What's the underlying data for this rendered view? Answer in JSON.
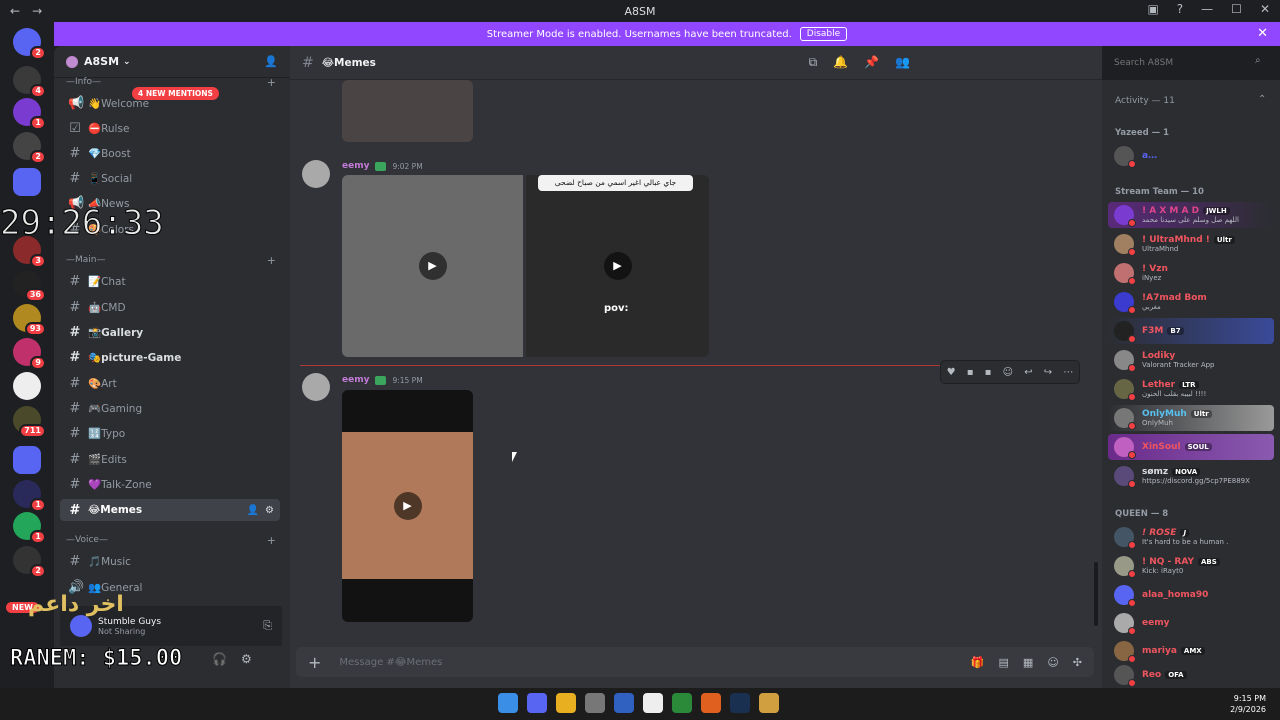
{
  "window": {
    "title": "A8SM"
  },
  "banner": {
    "text": "Streamer Mode is enabled. Usernames have been truncated.",
    "button": "Disable"
  },
  "guild": {
    "name": "A8SM",
    "mentions_pill": "4 NEW MENTIONS"
  },
  "server_rail": {
    "new_pill": "NEW",
    "badges": [
      "2",
      "4",
      "1",
      "2",
      "3",
      "36",
      "93",
      "9",
      "711",
      "1",
      "1",
      "2"
    ]
  },
  "categories": {
    "info": "—Info—",
    "main": "—Main—",
    "voice": "—Voice—"
  },
  "channels": [
    {
      "name": "👋Welcome"
    },
    {
      "name": "⛔Rulse"
    },
    {
      "name": "💎Boost"
    },
    {
      "name": "📱Social"
    },
    {
      "name": "📣News"
    },
    {
      "name": "🎨Colors"
    },
    {
      "name": "📝Chat"
    },
    {
      "name": "🤖CMD"
    },
    {
      "name": "📸Gallery"
    },
    {
      "name": "🎭picture-Game"
    },
    {
      "name": "🎨Art"
    },
    {
      "name": "🎮Gaming"
    },
    {
      "name": "🔢Typo"
    },
    {
      "name": "🎬Edits"
    },
    {
      "name": "💜Talk-Zone"
    },
    {
      "name": "😂Memes"
    },
    {
      "name": "🎵Music"
    },
    {
      "name": "👥General"
    }
  ],
  "overlay": {
    "timer": "29:26:33",
    "arabic": "اخر داعم",
    "donation": "RANEM: $15.00"
  },
  "user_panel": {
    "name": "Stumble Guys",
    "status": "Not Sharing"
  },
  "header": {
    "channel": "😂Memes",
    "search_placeholder": "Search A8SM"
  },
  "messages": [
    {
      "author": "eemy",
      "time": "9:02 PM",
      "caption": "جاي عبالي اغير اسمي من صباح لضحى",
      "overlay": "pov:"
    },
    {
      "author": "eemy",
      "time": "9:15 PM"
    }
  ],
  "composer": {
    "placeholder": "Message #😂Memes"
  },
  "members": {
    "activity": "Activity — 11",
    "groups": [
      {
        "title": "Yazeed — 1",
        "people": [
          {
            "name": "a…",
            "tag": "",
            "status": "",
            "color": "#5865f2"
          }
        ]
      },
      {
        "title": "Stream Team — 10",
        "people": [
          {
            "name": "! A X M A D",
            "tag": "JWLH",
            "status": "اللهم صل وسلم على سيدنا محمد",
            "color": "#e0458a"
          },
          {
            "name": "! UltraMhnd !",
            "tag": "Ultr",
            "status": "UltraMhnd",
            "color": "#f0555f"
          },
          {
            "name": "! Vzn",
            "tag": "",
            "status": "iNyez",
            "color": "#f0555f"
          },
          {
            "name": "!A7mad Bom",
            "tag": "",
            "status": "مغربي",
            "color": "#f0555f"
          },
          {
            "name": "F3M",
            "tag": "B7",
            "status": "",
            "color": "#f0555f"
          },
          {
            "name": "Lodiky",
            "tag": "",
            "status": "Valorant Tracker App",
            "color": "#f0555f"
          },
          {
            "name": "Lether",
            "tag": "LTR",
            "status": "لبيبه بقلب الحنون !!!!",
            "color": "#f0555f"
          },
          {
            "name": "OnlyMuh",
            "tag": "Ultr",
            "status": "OnlyMuh",
            "color": "#58c0f0"
          },
          {
            "name": "XinSoul",
            "tag": "SOUL",
            "status": "",
            "color": "#f0555f"
          },
          {
            "name": "sømz",
            "tag": "NOVA",
            "status": "https://discord.gg/5cp7PE889X",
            "color": "#dbdee1"
          }
        ]
      },
      {
        "title": "QUEEN — 8",
        "people": [
          {
            "name": "! ROSE",
            "tag": "J",
            "status": "It's hard to be a human .",
            "color": "#f0555f"
          },
          {
            "name": "! NQ - RAY",
            "tag": "ABS",
            "status": "Kick: iRayt0",
            "color": "#f0555f"
          },
          {
            "name": "alaa_homa90",
            "tag": "",
            "status": "",
            "color": "#f0555f"
          },
          {
            "name": "eemy",
            "tag": "",
            "status": "",
            "color": "#f0555f"
          },
          {
            "name": "mariya",
            "tag": "AMX",
            "status": "",
            "color": "#f0555f"
          },
          {
            "name": "Reo",
            "tag": "OFA",
            "status": "",
            "color": "#f0555f"
          }
        ]
      }
    ]
  },
  "taskbar": {
    "time": "9:15 PM",
    "date": "2/9/2026"
  },
  "colors": {
    "accent": "#9147ff",
    "mention": "#f23f43",
    "author": "#c27bd6"
  }
}
